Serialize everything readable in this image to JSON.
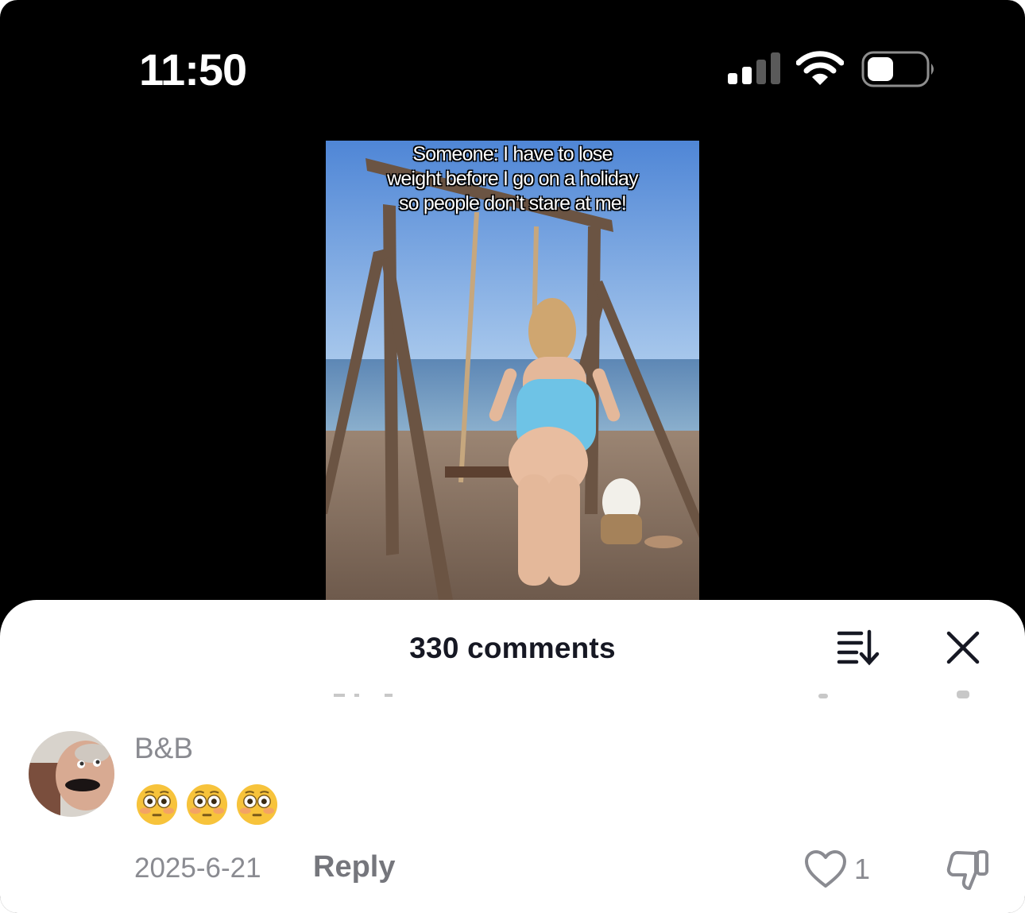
{
  "status_bar": {
    "time": "11:50"
  },
  "video": {
    "caption": "Someone: I have to lose\nweight before I go on a holiday\nso people don’t stare at me!"
  },
  "comments_sheet": {
    "title": "330 comments",
    "comments": [
      {
        "username": "B&B",
        "text_emojis": [
          "flushed-face-emoji",
          "flushed-face-emoji",
          "flushed-face-emoji"
        ],
        "date": "2025-6-21",
        "reply_label": "Reply",
        "like_count": "1"
      }
    ]
  },
  "colors": {
    "background_dark": "#000000",
    "sheet": "#ffffff",
    "title_text": "#161823",
    "secondary_text": "#8a8b91"
  }
}
